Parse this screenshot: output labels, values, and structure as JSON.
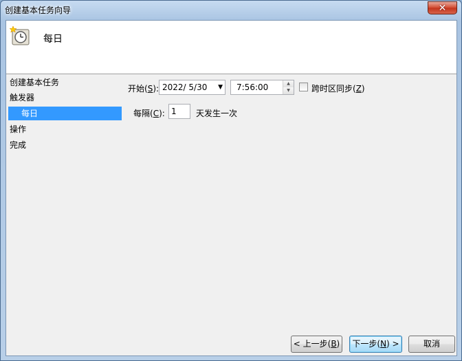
{
  "window": {
    "title": "创建基本任务向导"
  },
  "header": {
    "title": "每日"
  },
  "nav": {
    "items": [
      {
        "label": "创建基本任务"
      },
      {
        "label": "触发器"
      },
      {
        "label": "每日"
      },
      {
        "label": "操作"
      },
      {
        "label": "完成"
      }
    ]
  },
  "form": {
    "start_label": "开始(",
    "start_key": "S",
    "start_suffix": "):",
    "date_value": "2022/  5/30",
    "time_value": "7:56:00",
    "sync_label": "跨时区同步(",
    "sync_key": "Z",
    "sync_suffix": ")",
    "sync_checked": false,
    "every_label": "每隔(",
    "every_key": "C",
    "every_suffix": "):",
    "every_value": "1",
    "every_unit": "天发生一次"
  },
  "buttons": {
    "back": {
      "pre": "< 上一步(",
      "key": "B",
      "post": ")"
    },
    "next": {
      "pre": "下一步(",
      "key": "N",
      "post": ") >"
    },
    "cancel": "取消"
  }
}
